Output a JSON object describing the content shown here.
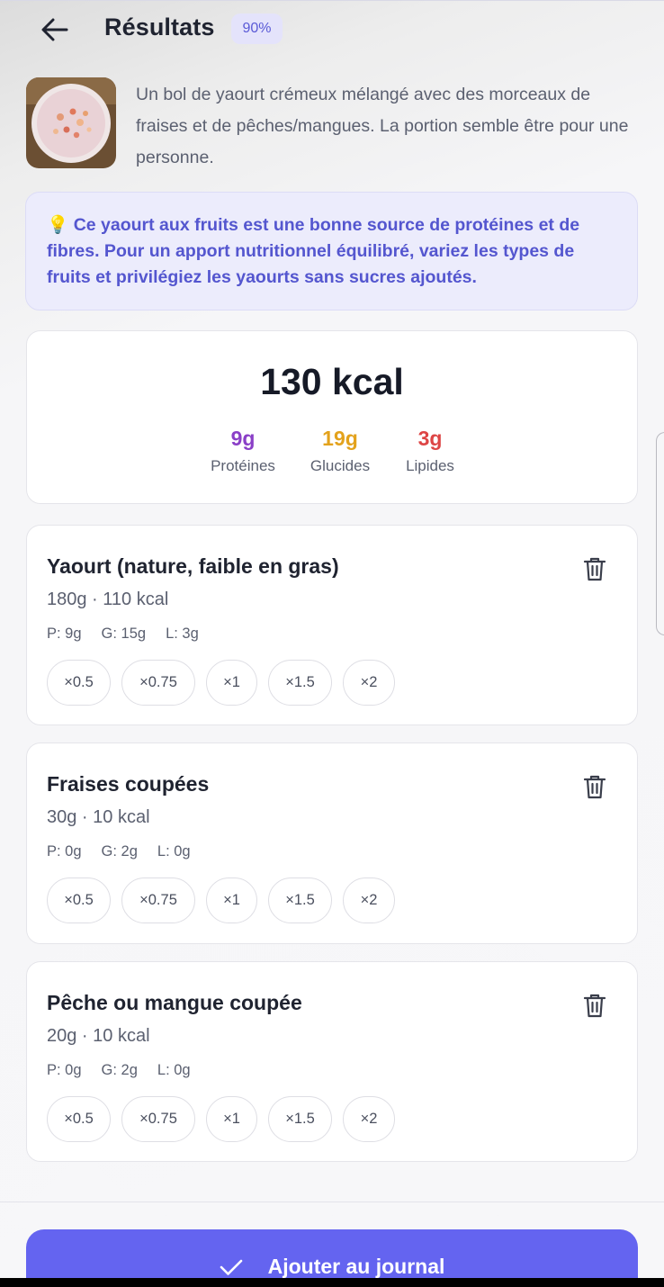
{
  "header": {
    "title": "Résultats",
    "confidence_badge": "90%",
    "back_icon": "arrow-left-icon"
  },
  "summary": {
    "description": "Un bol de yaourt crémeux mélangé avec des morceaux de fraises et de pêches/mangues. La portion semble être pour une personne."
  },
  "tip": {
    "icon": "lightbulb-icon",
    "text": "Ce yaourt aux fruits est une bonne source de protéines et de fibres. Pour un apport nutritionnel équilibré, variez les types de fruits et privilégiez les yaourts sans sucres ajoutés."
  },
  "totals": {
    "calories": "130 kcal",
    "macros": [
      {
        "value": "9g",
        "label": "Protéines",
        "color": "#8a3fc7"
      },
      {
        "value": "19g",
        "label": "Glucides",
        "color": "#e3a21c"
      },
      {
        "value": "3g",
        "label": "Lipides",
        "color": "#dd4545"
      }
    ]
  },
  "foods": [
    {
      "name": "Yaourt (nature, faible en gras)",
      "summary": "180g · 110 kcal",
      "macros": [
        "P: 9g",
        "G: 15g",
        "L: 3g"
      ],
      "multipliers": [
        "×0.5",
        "×0.75",
        "×1",
        "×1.5",
        "×2"
      ]
    },
    {
      "name": "Fraises coupées",
      "summary": "30g · 10 kcal",
      "macros": [
        "P: 0g",
        "G: 2g",
        "L: 0g"
      ],
      "multipliers": [
        "×0.5",
        "×0.75",
        "×1",
        "×1.5",
        "×2"
      ]
    },
    {
      "name": "Pêche ou mangue coupée",
      "summary": "20g · 10 kcal",
      "macros": [
        "P: 0g",
        "G: 2g",
        "L: 0g"
      ],
      "multipliers": [
        "×0.5",
        "×0.75",
        "×1",
        "×1.5",
        "×2"
      ]
    }
  ],
  "actions": {
    "add_label": "Ajouter au journal",
    "add_icon": "checkmark-icon"
  },
  "colors": {
    "accent": "#6464f0",
    "tip_text": "#5456cf",
    "badge_bg": "#e4e3fb"
  }
}
